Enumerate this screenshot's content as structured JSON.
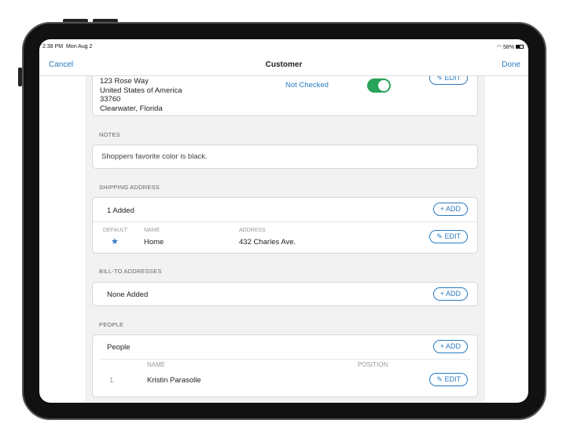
{
  "status": {
    "time": "2:38 PM",
    "date": "Mon Aug 2",
    "battery": "58%"
  },
  "nav": {
    "cancel": "Cancel",
    "title": "Customer",
    "done": "Done"
  },
  "address": {
    "line1": "123 Rose Way",
    "line2": "United States of America",
    "line3": "33760",
    "line4": "Clearwater, Florida",
    "check_status": "Not Checked",
    "toggle_on": true,
    "edit": "EDIT"
  },
  "notes": {
    "label": "NOTES",
    "value": "Shoppers favorite color is black."
  },
  "shipping": {
    "label": "SHIPPING ADDRESS",
    "count": "1 Added",
    "add": "ADD",
    "headers": {
      "default": "DEFAULT",
      "name": "NAME",
      "address": "ADDRESS"
    },
    "rows": [
      {
        "default_icon": "star-icon",
        "name": "Home",
        "address": "432 Charles Ave.",
        "edit": "EDIT"
      }
    ]
  },
  "billto": {
    "label": "BILL-TO ADDRESSES",
    "count": "None Added",
    "add": "ADD"
  },
  "people": {
    "label": "PEOPLE",
    "title": "People",
    "add": "ADD",
    "headers": {
      "name": "NAME",
      "position": "POSITION"
    },
    "rows": [
      {
        "index": "1",
        "name": "Kristin Parasolle",
        "position": "",
        "edit": "EDIT"
      }
    ]
  },
  "colors": {
    "accent": "#2a7bc0",
    "toggle": "#27a35a"
  }
}
